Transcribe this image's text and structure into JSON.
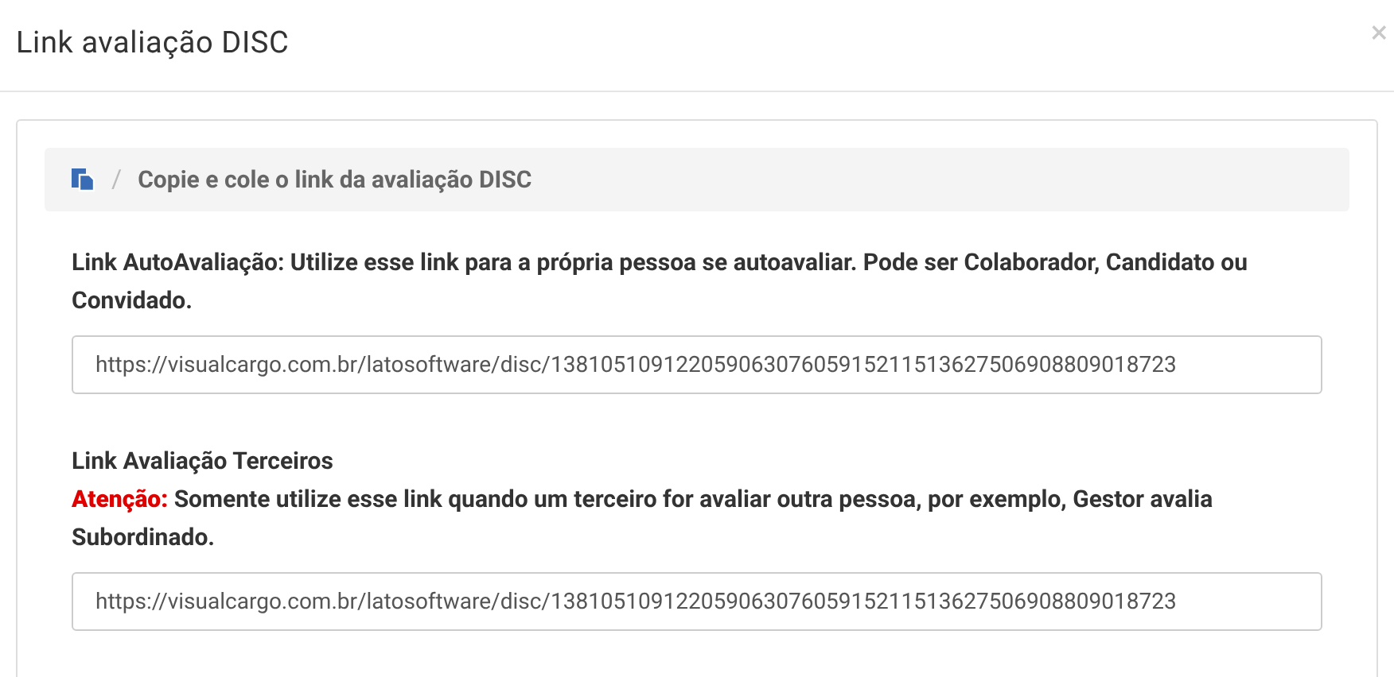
{
  "window": {
    "title": "Link avaliação DISC",
    "close": "×"
  },
  "breadcrumb": {
    "separator": "/",
    "text": "Copie e cole o link da avaliação DISC"
  },
  "sections": [
    {
      "label": "Link AutoAvaliação: Utilize esse link para a própria pessoa se autoavaliar. Pode ser Colaborador, Candidato ou Convidado.",
      "value": "https://visualcargo.com.br/latosoftware/disc/13810510912205906307605915211513627506908809018723"
    },
    {
      "label": "Link Avaliação Terceiros",
      "note": "**Atenção:** Somente utilize esse link quando um terceiro for avaliar outra pessoa, por exemplo, Gestor avalia Subordinado.",
      "value": "https://visualcargo.com.br/latosoftware/disc/13810510912205906307605915211513627506908809018723"
    }
  ]
}
